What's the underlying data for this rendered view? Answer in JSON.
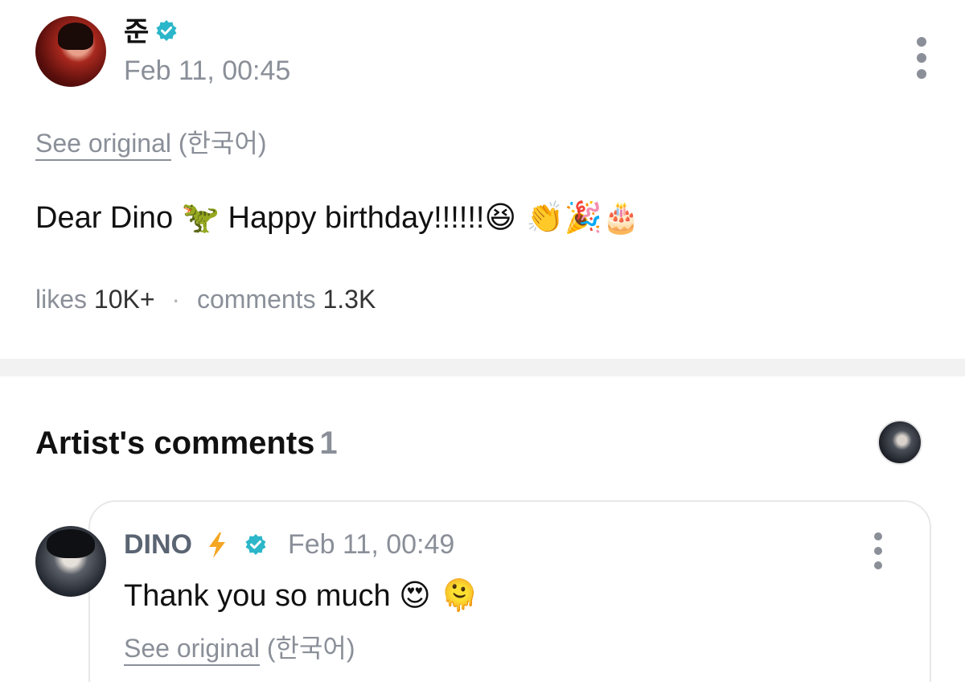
{
  "post": {
    "author_name": "준",
    "date": "Feb 11, 00:45",
    "see_original_label": "See original",
    "original_language": "(한국어)",
    "body_text": "Dear Dino",
    "body_emoji_1": "🦖",
    "body_text_2": "Happy birthday!!!!!!",
    "body_emoji_2": "😆 👏🎉🎂",
    "likes_label": "likes",
    "likes_value": "10K+",
    "separator": "·",
    "comments_label": "comments",
    "comments_value": "1.3K"
  },
  "artist_comments": {
    "title": "Artist's comments",
    "count": "1",
    "comment": {
      "author_name": "DINO",
      "date": "Feb 11, 00:49",
      "body_text": "Thank you so much",
      "body_emoji": "😍 🫠",
      "see_original_label": "See original",
      "original_language": "(한국어)"
    }
  },
  "colors": {
    "verified": "#2bb6c9",
    "bolt": "#f5a623",
    "muted_text": "#8a8f98",
    "divider": "#f2f2f3"
  },
  "icons": [
    "verified-badge-icon",
    "more-options-icon",
    "lightning-bolt-icon"
  ]
}
